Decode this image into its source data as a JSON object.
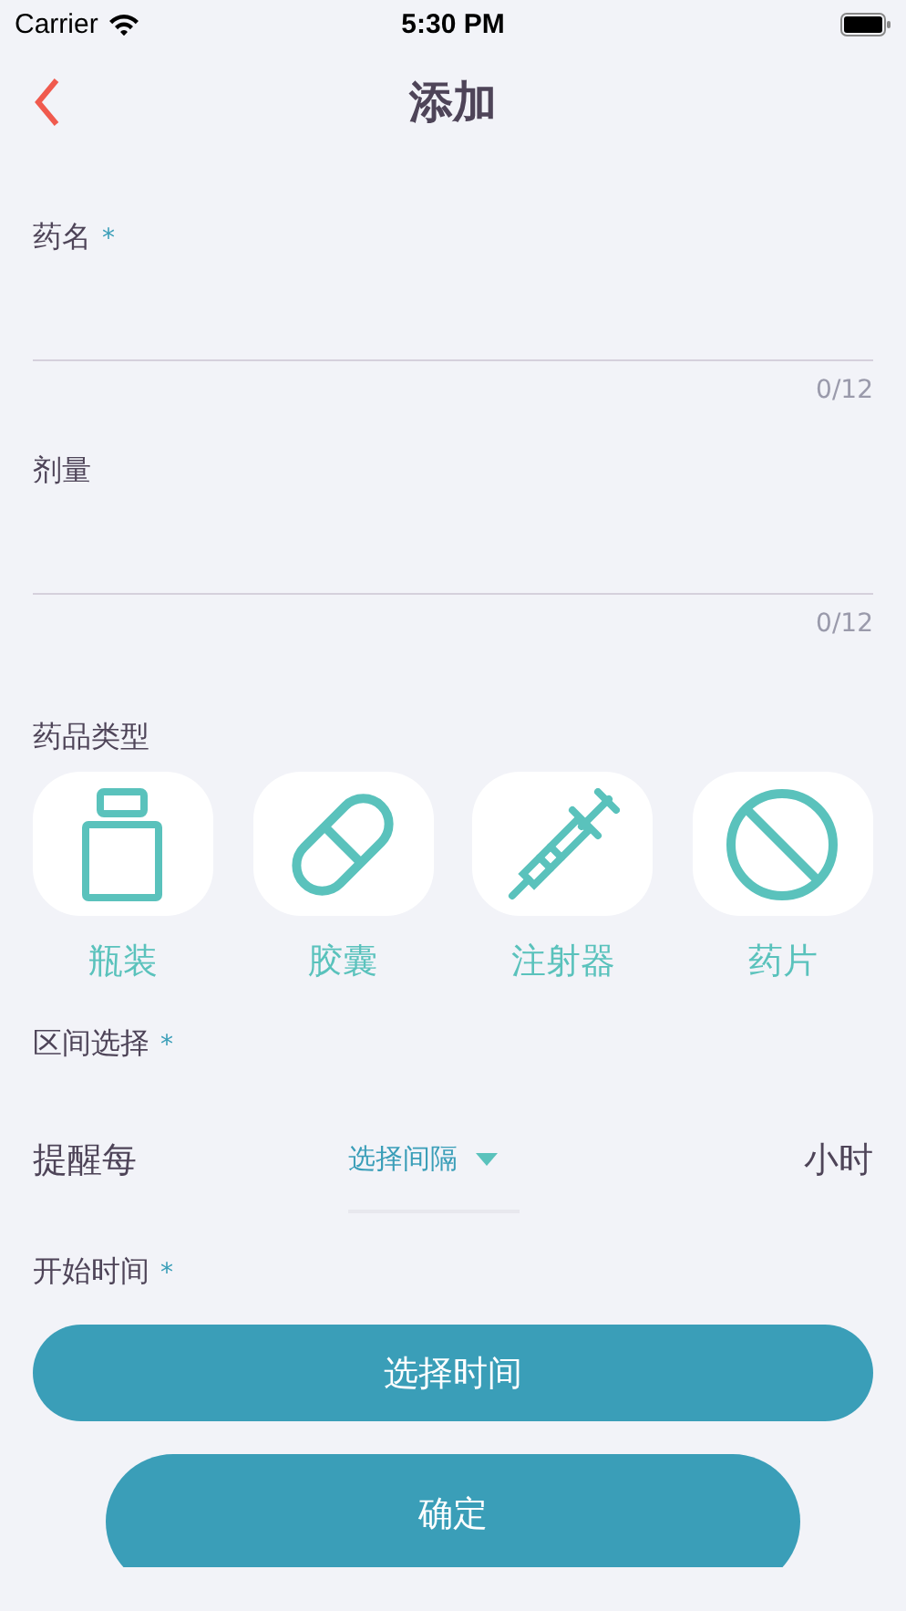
{
  "status_bar": {
    "carrier": "Carrier",
    "time": "5:30 PM"
  },
  "nav": {
    "title": "添加"
  },
  "fields": [
    {
      "label": "药名",
      "required_mark": "*",
      "counter": "0/12"
    },
    {
      "label": "剂量",
      "counter": "0/12"
    }
  ],
  "medicine_type": {
    "label": "药品类型",
    "options": [
      {
        "kind": "bottle",
        "label": "瓶装"
      },
      {
        "kind": "capsule",
        "label": "胶囊"
      },
      {
        "kind": "syringe",
        "label": "注射器"
      },
      {
        "kind": "tablet",
        "label": "药片"
      }
    ]
  },
  "interval": {
    "label": "区间选择",
    "required_mark": "*",
    "prefix": "提醒每",
    "dropdown_placeholder": "选择间隔",
    "unit": "小时"
  },
  "start_time": {
    "label": "开始时间",
    "required_mark": "*",
    "button": "选择时间"
  },
  "confirm_button": "确定"
}
